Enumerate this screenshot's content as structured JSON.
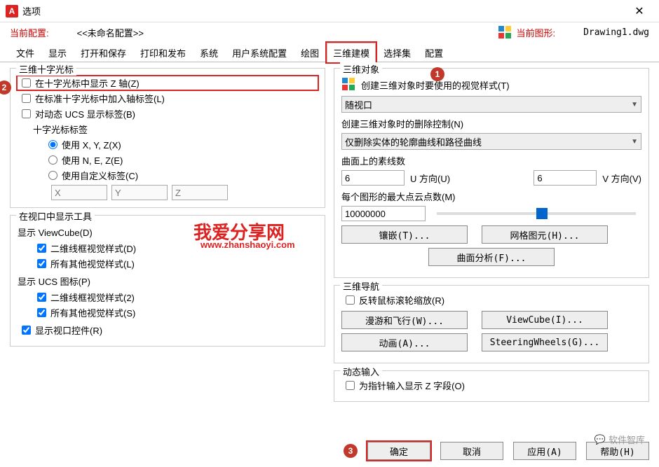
{
  "titlebar": {
    "title": "选项"
  },
  "inforow": {
    "profile_label": "当前配置:",
    "profile_value": "<<未命名配置>>",
    "drawing_label": "当前图形:",
    "drawing_value": "Drawing1.dwg"
  },
  "tabs": [
    "文件",
    "显示",
    "打开和保存",
    "打印和发布",
    "系统",
    "用户系统配置",
    "绘图",
    "三维建模",
    "选择集",
    "配置"
  ],
  "active_tab_index": 7,
  "crosshair": {
    "group": "三维十字光标",
    "show_z": "在十字光标中显示 Z 轴(Z)",
    "std_labels": "在标准十字光标中加入轴标签(L)",
    "ucs_labels": "对动态 UCS 显示标签(B)",
    "label_title": "十字光标标签",
    "r1": "使用 X, Y, Z(X)",
    "r2": "使用 N, E, Z(E)",
    "r3": "使用自定义标签(C)",
    "ph_x": "X",
    "ph_y": "Y",
    "ph_z": "Z"
  },
  "viewport_tools": {
    "group": "在视口中显示工具",
    "vc_title": "显示 ViewCube(D)",
    "vc1": "二维线框视觉样式(D)",
    "vc2": "所有其他视觉样式(L)",
    "ucs_title": "显示 UCS 图标(P)",
    "ucs1": "二维线框视觉样式(2)",
    "ucs2": "所有其他视觉样式(S)",
    "vp_controls": "显示视口控件(R)"
  },
  "objects3d": {
    "group": "三维对象",
    "visual_style_label": "创建三维对象时要使用的视觉样式(T)",
    "visual_style_value": "随视口",
    "delete_label": "创建三维对象时的删除控制(N)",
    "delete_value": "仅删除实体的轮廓曲线和路径曲线",
    "isolines_label": "曲面上的素线数",
    "u_value": "6",
    "u_label": "U 方向(U)",
    "v_value": "6",
    "v_label": "V 方向(V)",
    "maxpoints_label": "每个图形的最大点云点数(M)",
    "maxpoints_value": "10000000",
    "btn_tess": "镶嵌(T)...",
    "btn_mesh": "网格图元(H)...",
    "btn_analysis": "曲面分析(F)..."
  },
  "nav3d": {
    "group": "三维导航",
    "reverse": "反转鼠标滚轮缩放(R)",
    "btn_walk": "漫游和飞行(W)...",
    "btn_vc": "ViewCube(I)...",
    "btn_anim": "动画(A)...",
    "btn_sw": "SteeringWheels(G)..."
  },
  "dyninput": {
    "group": "动态输入",
    "show_z": "为指针输入显示 Z 字段(O)"
  },
  "footer": {
    "ok": "确定",
    "cancel": "取消",
    "apply": "应用(A)",
    "help": "帮助(H)"
  },
  "watermark": {
    "line1": "我爱分享网",
    "line2": "www.zhanshaoyi.com"
  },
  "brand": "软件智库",
  "callouts": {
    "c1": "1",
    "c2": "2",
    "c3": "3"
  }
}
